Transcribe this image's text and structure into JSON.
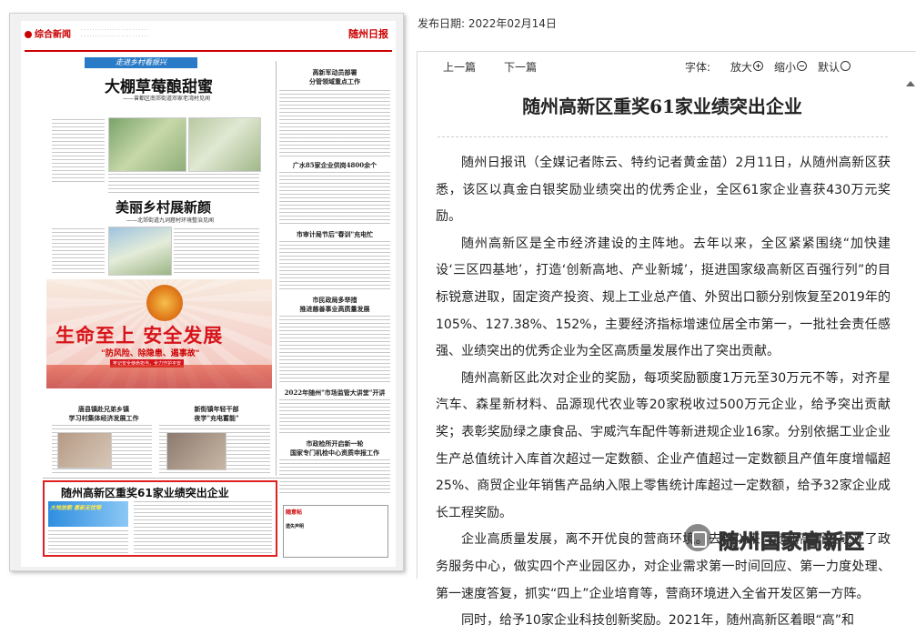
{
  "publish_date": "发布日期: 2022年02月14日",
  "newspaper": {
    "section": "综合新闻",
    "brand": "随州日报",
    "tag": "走进乡村看振兴",
    "story1_title": "大棚草莓酿甜蜜",
    "story1_sub": "——曾都区南郊街道邓家老湾村见闻",
    "story2_title": "美丽乡村展新颜",
    "story2_sub": "——北郊街道九词窟村环境整治见闻",
    "poster_slogan": "生命至上 安全发展",
    "poster_sub": "\"防风险、除隐患、遏事故\"",
    "poster_small": "牢记安全使命担当，全力守护平安",
    "col_left_title": "唐县镇赴兄弟乡镇\n学习村集体经济发展工作",
    "col_mid_title": "新街镇年轻干部\n夜学\"充电蓄能\"",
    "right_titles": [
      "高新军动员部署\n分管领域重点工作",
      "广水85家企业供岗4800余个",
      "市审计局节后\"春训\"充电忙",
      "市民政局多举措\n推进慈善事业高质量发展",
      "2022年随州\"市场监管大讲堂\"开讲",
      "市政检所开启新一轮\n国家专门机检中心资质申报工作"
    ],
    "highlight_title": "随州高新区重奖61家业绩突出企业",
    "highlight_badge": "大地放歌 喜新无忧等",
    "ad_title": "随意帖",
    "ad_notice": "遗失声明"
  },
  "reader": {
    "toolbar": {
      "prev": "上一篇",
      "next": "下一篇",
      "font_label": "字体:",
      "zoom_in": "放大",
      "zoom_out": "缩小",
      "default": "默认"
    },
    "title": "随州高新区重奖61家业绩突出企业",
    "paragraphs": [
      "随州日报讯（全媒记者陈云、特约记者黄金苗）2月11日，从随州高新区获悉，该区以真金白银奖励业绩突出的优秀企业，全区61家企业喜获430万元奖励。",
      "随州高新区是全市经济建设的主阵地。去年以来，全区紧紧围绕“加快建设‘三区四基地’，打造‘创新高地、产业新城’，挺进国家级高新区百强行列”的目标锐意进取，固定资产投资、规上工业总产值、外贸出口额分别恢复至2019年的105%、127.38%、152%，主要经济指标增速位居全市第一，一批社会责任感强、业绩突出的优秀企业为全区高质量发展作出了突出贡献。",
      "随州高新区此次对企业的奖励，每项奖励额度1万元至30万元不等，对齐星汽车、森星新材料、品源现代农业等20家税收过500万元企业，给予突出贡献奖；表彰奖励绿之康食品、宇威汽车配件等新进规企业16家。分别依据工业企业生产总值统计入库首次超过一定数额、企业产值超过一定数额且产值年度增幅超25%、商贸企业年销售产品纳入限上零售统计库超过一定数额，给予32家企业成长工程奖励。",
      "企业高质量发展，离不开优良的营商环境。去年以来，随州高新区成立了政务服务中心，做实四个产业园区办，对企业需求第一时间回应、第一力度处理、第一速度答复，抓实“四上”企业培育等，营商环境进入全省开发区第一方阵。",
      "同时，给予10家企业科技创新奖励。2021年，随州高新区着眼“高”和"
    ]
  },
  "watermark": "随州国家高新区"
}
